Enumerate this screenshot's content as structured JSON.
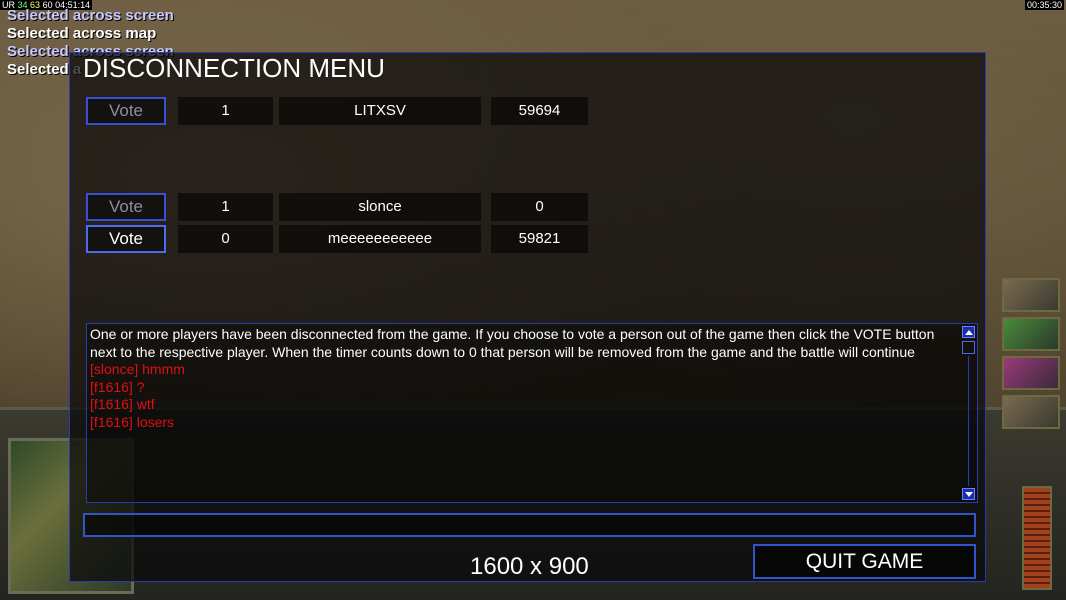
{
  "overlay": {
    "fps_label": "UR",
    "fps_values": [
      "34",
      "63",
      "60"
    ],
    "fps_time": "04:51:14",
    "clock": "00:35:30",
    "messages": [
      "Selected across screen",
      "Selected across map",
      "Selected across screen",
      "Selected a"
    ]
  },
  "dialog": {
    "title": "DISCONNECTION MENU",
    "vote_label": "Vote",
    "players": [
      {
        "vote_label": "Vote",
        "votes": "1",
        "name": "LITXSV",
        "value": "59694",
        "active": false
      },
      {
        "vote_label": "Vote",
        "votes": "1",
        "name": "slonce",
        "value": "0",
        "active": false
      },
      {
        "vote_label": "Vote",
        "votes": "0",
        "name": "meeeeeeeeeee",
        "value": "59821",
        "active": true
      }
    ],
    "chat": {
      "system_message": "One or more players have been disconnected from the game. If you choose to vote a person out of the game then click the VOTE button next to the respective player. When the timer counts down to 0 that person will be removed from the game and the battle will continue",
      "lines": [
        "[slonce] hmmm",
        "[f1616] ?",
        "[f1616] wtf",
        "[f1616] losers"
      ]
    },
    "chat_input_value": "",
    "resolution_text": "1600 x 900",
    "quit_label": "QUIT GAME"
  },
  "colors": {
    "accent_border": "#2f55c8",
    "chat_red": "#e01010"
  }
}
